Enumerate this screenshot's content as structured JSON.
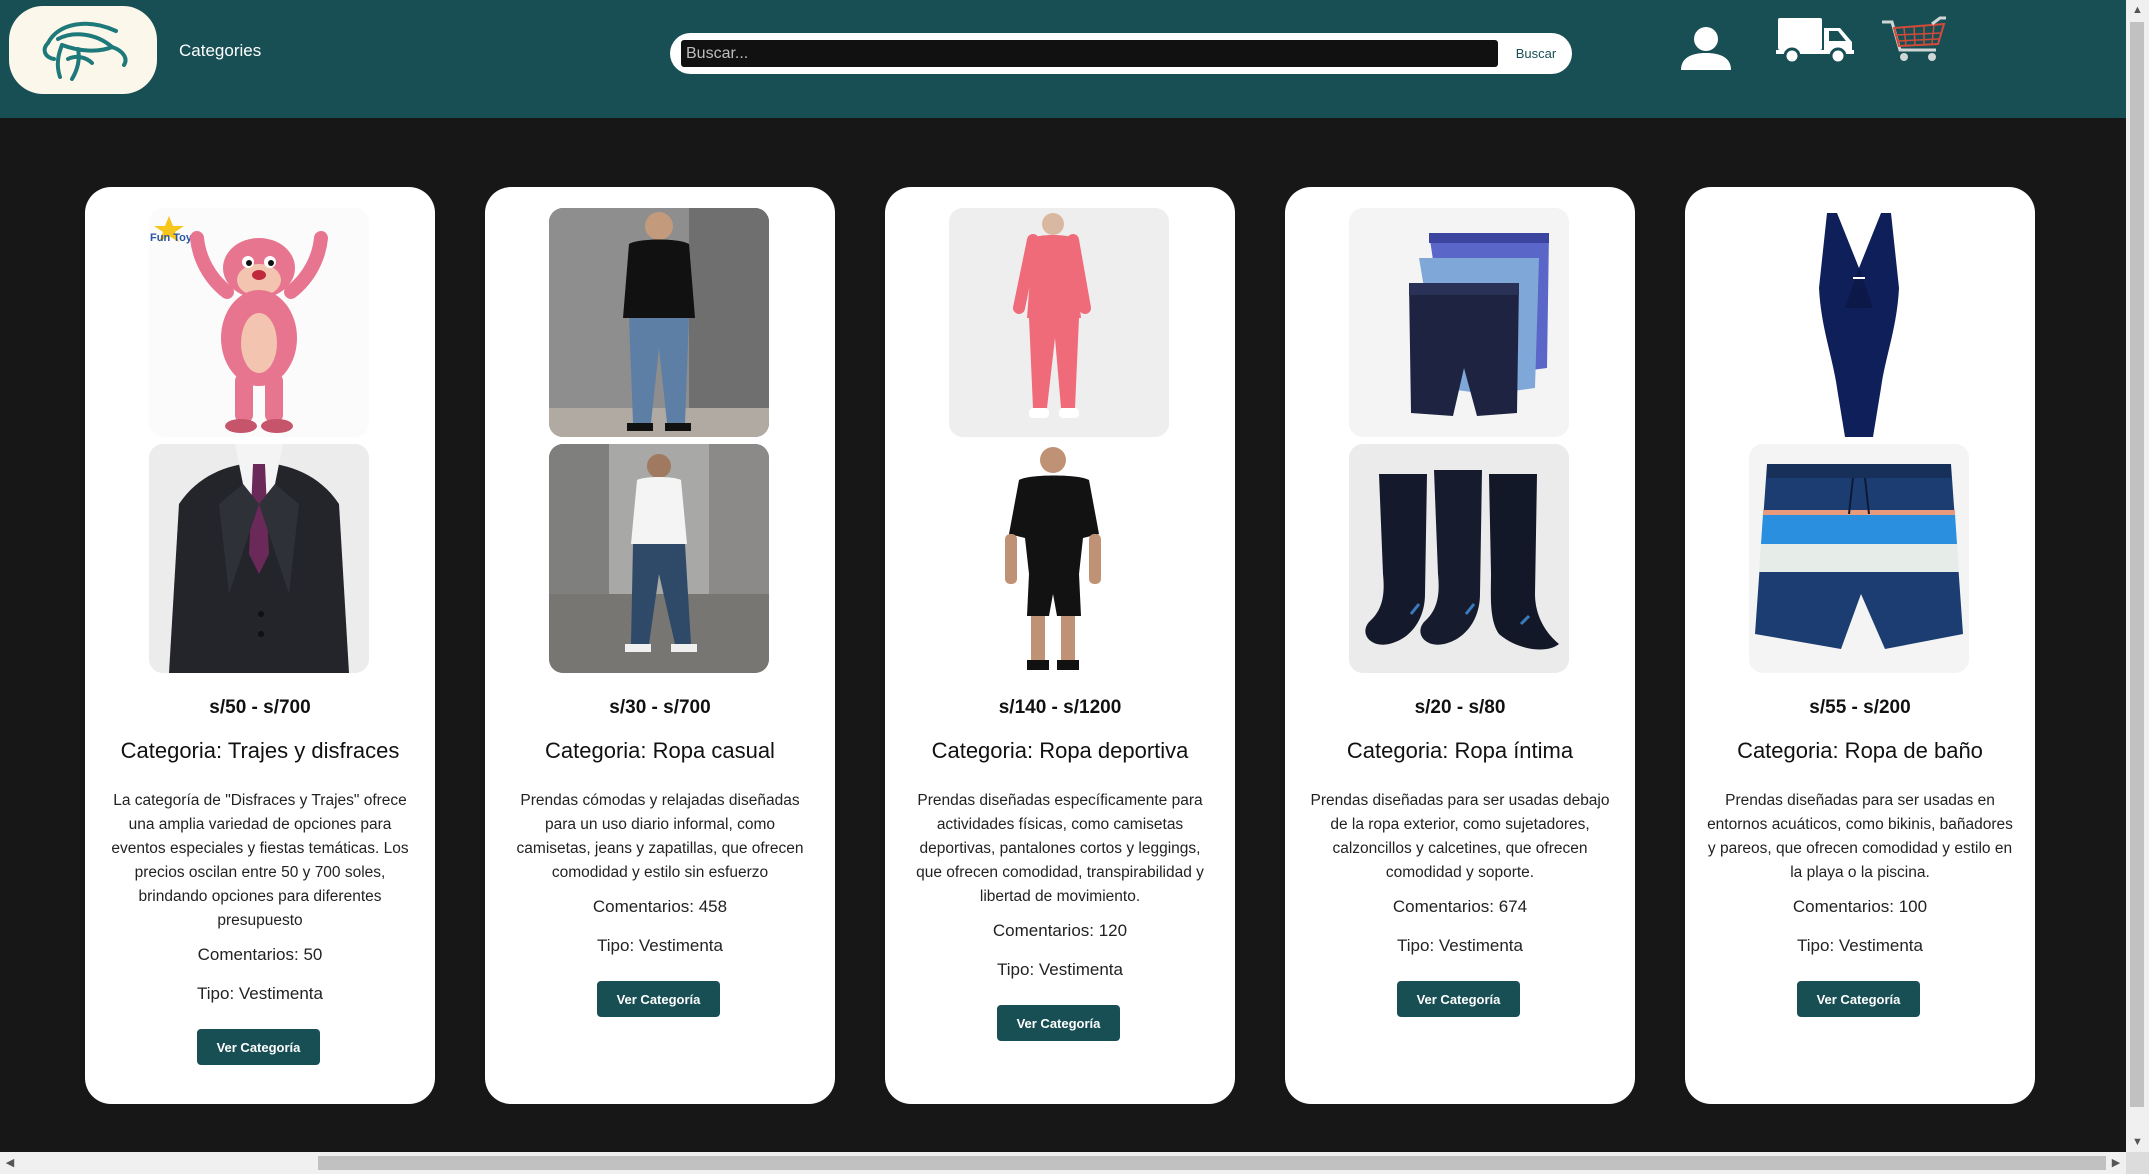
{
  "header": {
    "nav_categories": "Categories",
    "search": {
      "placeholder": "Buscar...",
      "button_label": "Buscar"
    },
    "icons": [
      "logo-hat-icon",
      "user-icon",
      "truck-icon",
      "cart-icon"
    ],
    "colors": {
      "header_bg": "#184f55",
      "logo_bg": "#fbf7ea",
      "page_bg": "#171717"
    }
  },
  "cards": [
    {
      "price": "s/50 - s/700",
      "title": "Categoria: Trajes y disfraces",
      "description": "La categoría de \"Disfraces y Trajes\" ofrece una amplia variedad de opciones para eventos especiales y fiestas temáticas. Los precios oscilan entre 50 y 700 soles, brindando opciones para diferentes presupuesto",
      "comments": "Comentarios: 50",
      "tipo": "Tipo: Vestimenta",
      "button": "Ver Categoría",
      "images": [
        "pink-panther-costume-image",
        "black-suit-image"
      ],
      "badge": "Fun Toys"
    },
    {
      "price": "s/30 - s/700",
      "title": "Categoria: Ropa casual",
      "description": "Prendas cómodas y relajadas diseñadas para un uso diario informal, como camisetas, jeans y zapatillas, que ofrecen comodidad y estilo sin esfuerzo",
      "comments": "Comentarios: 458",
      "tipo": "Tipo: Vestimenta",
      "button": "Ver Categoría",
      "images": [
        "casual-jeans-woman-image",
        "casual-white-shirt-man-image"
      ]
    },
    {
      "price": "s/140 - s/1200",
      "title": "Categoria: Ropa deportiva",
      "description": "Prendas diseñadas específicamente para actividades físicas, como camisetas deportivas, pantalones cortos y leggings, que ofrecen comodidad, transpirabilidad y libertad de movimiento.",
      "comments": "Comentarios: 120",
      "tipo": "Tipo: Vestimenta",
      "button": "Ver Categoría",
      "images": [
        "pink-tracksuit-image",
        "black-sportswear-man-image"
      ]
    },
    {
      "price": "s/20 - s/80",
      "title": "Categoria: Ropa íntima",
      "description": "Prendas diseñadas para ser usadas debajo de la ropa exterior, como sujetadores, calzoncillos y calcetines, que ofrecen comodidad y soporte.",
      "comments": "Comentarios: 674",
      "tipo": "Tipo: Vestimenta",
      "button": "Ver Categoría",
      "images": [
        "boxer-shorts-image",
        "black-socks-image"
      ]
    },
    {
      "price": "s/55 - s/200",
      "title": "Categoria: Ropa de baño",
      "description": "Prendas diseñadas para ser usadas en entornos acuáticos, como bikinis, bañadores y pareos, que ofrecen comodidad y estilo en la playa o la piscina.",
      "comments": "Comentarios: 100",
      "tipo": "Tipo: Vestimenta",
      "button": "Ver Categoría",
      "images": [
        "navy-swimsuit-image",
        "striped-swim-shorts-image"
      ]
    }
  ]
}
